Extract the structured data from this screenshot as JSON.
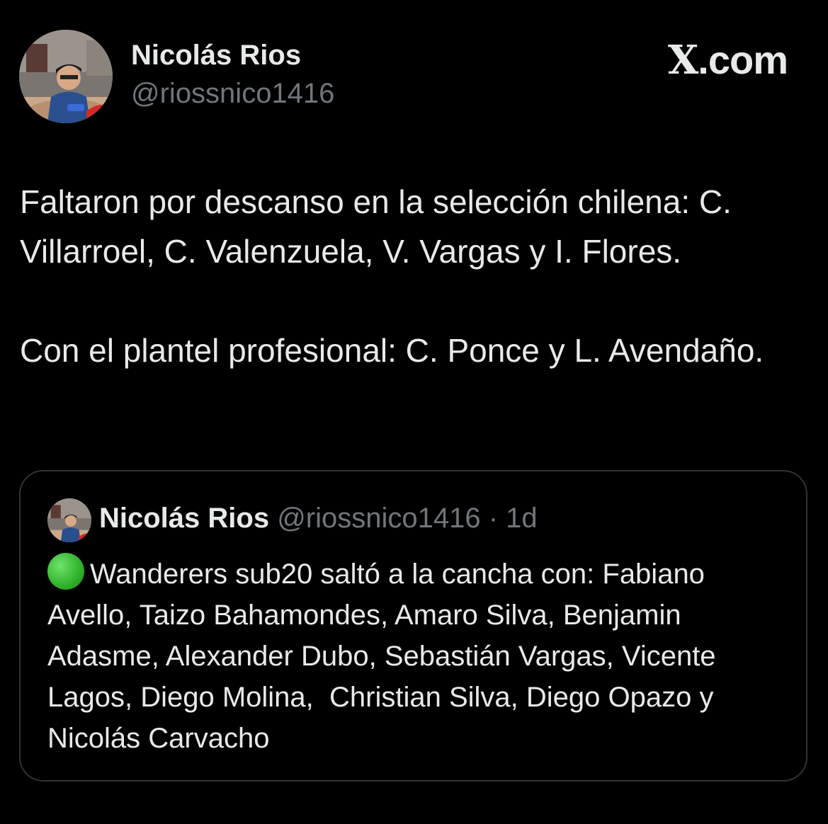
{
  "author": {
    "name": "Nicolás Rios",
    "handle": "@riossnico1416"
  },
  "brand": {
    "x_mark": "X",
    "suffix": ".com"
  },
  "tweet": {
    "text": "Faltaron por descanso en la selección chilena: C. Villarroel, C. Valenzuela, V. Vargas y I. Flores.\n\nCon el plantel profesional: C. Ponce y L. Avendaño."
  },
  "quoted_tweet": {
    "name": "Nicolás Rios",
    "handle": "@riossnico1416",
    "separator": " · ",
    "time": "1d",
    "emoji_icon": "green-circle-icon",
    "text": "Wanderers sub20 saltó a la cancha con: Fabiano Avello, Taizo Bahamondes, Amaro Silva, Benjamin Adasme, Alexander Dubo, Sebastián Vargas, Vicente Lagos, Diego Molina,  Christian Silva, Diego Opazo y Nicolás Carvacho"
  },
  "colors": {
    "background": "#000000",
    "primary_text": "#e7e9ea",
    "secondary_text": "#71767b",
    "card_border": "#2f3336",
    "emoji_green": "#2fb12a"
  }
}
